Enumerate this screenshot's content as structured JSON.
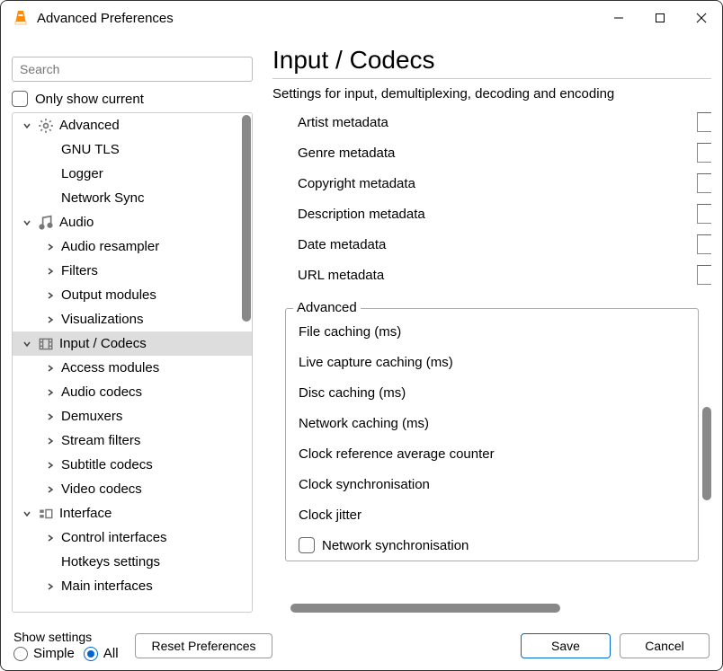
{
  "window": {
    "title": "Advanced Preferences"
  },
  "sidebar": {
    "search_placeholder": "Search",
    "only_show_current": "Only show current",
    "tree": [
      {
        "label": "Advanced",
        "expanded": true,
        "icon": "gear",
        "children": [
          {
            "label": "GNU TLS"
          },
          {
            "label": "Logger"
          },
          {
            "label": "Network Sync"
          }
        ]
      },
      {
        "label": "Audio",
        "expanded": true,
        "icon": "music",
        "children": [
          {
            "label": "Audio resampler",
            "hasChildren": true
          },
          {
            "label": "Filters",
            "hasChildren": true
          },
          {
            "label": "Output modules",
            "hasChildren": true
          },
          {
            "label": "Visualizations",
            "hasChildren": true
          }
        ]
      },
      {
        "label": "Input / Codecs",
        "expanded": true,
        "icon": "codec",
        "selected": true,
        "children": [
          {
            "label": "Access modules",
            "hasChildren": true
          },
          {
            "label": "Audio codecs",
            "hasChildren": true
          },
          {
            "label": "Demuxers",
            "hasChildren": true
          },
          {
            "label": "Stream filters",
            "hasChildren": true
          },
          {
            "label": "Subtitle codecs",
            "hasChildren": true
          },
          {
            "label": "Video codecs",
            "hasChildren": true
          }
        ]
      },
      {
        "label": "Interface",
        "expanded": true,
        "icon": "interface",
        "children": [
          {
            "label": "Control interfaces",
            "hasChildren": true
          },
          {
            "label": "Hotkeys settings"
          },
          {
            "label": "Main interfaces",
            "hasChildren": true
          }
        ]
      }
    ]
  },
  "page": {
    "title": "Input / Codecs",
    "description": "Settings for input, demultiplexing, decoding and encoding",
    "metadata_rows": [
      "Artist metadata",
      "Genre metadata",
      "Copyright metadata",
      "Description metadata",
      "Date metadata",
      "URL metadata"
    ],
    "advanced_section": {
      "title": "Advanced",
      "rows": [
        "File caching (ms)",
        "Live capture caching (ms)",
        "Disc caching (ms)",
        "Network caching (ms)",
        "Clock reference average counter",
        "Clock synchronisation",
        "Clock jitter"
      ],
      "checkbox": "Network synchronisation"
    }
  },
  "footer": {
    "show_settings": "Show settings",
    "simple": "Simple",
    "all": "All",
    "reset": "Reset Preferences",
    "save": "Save",
    "cancel": "Cancel"
  }
}
